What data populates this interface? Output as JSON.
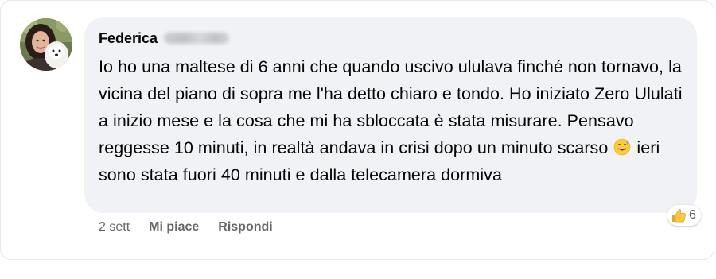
{
  "comment": {
    "author_name": "Federica",
    "text_before_emoji": "Io ho una maltese di 6 anni che quando uscivo ululava finché non tornavo, la vicina del piano di sopra me l'ha detto chiaro e tondo. Ho iniziato Zero Ululati a inizio mese e la cosa che mi ha sbloccata è stata misurare. Pensavo reggesse 10 minuti, in realtà andava in crisi dopo un minuto scarso",
    "emoji": "grinning-face-with-sweat-emoji",
    "text_after_emoji": "ieri sono stata fuori 40 minuti e dalla telecamera dormiva"
  },
  "actions": {
    "time": "2 sett",
    "like_label": "Mi piace",
    "reply_label": "Rispondi"
  },
  "reactions": {
    "icon": "thumbs-up-emoji",
    "count": "6"
  },
  "colors": {
    "bubble": "#f0f2f5",
    "text": "#050505",
    "secondary_text": "#65676b"
  }
}
